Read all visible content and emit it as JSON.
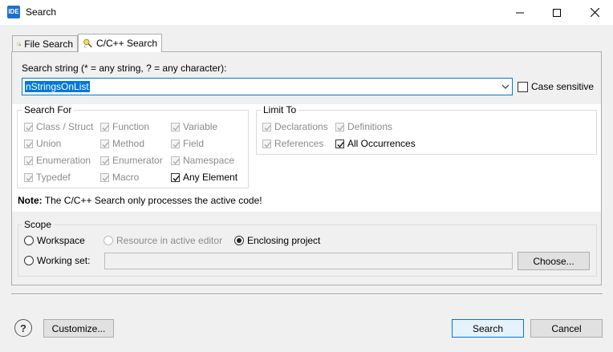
{
  "window": {
    "title": "Search",
    "app_icon_text": "IDE",
    "accent": "#0078d7"
  },
  "tabs": [
    {
      "label": "File Search",
      "icon": "file-search-icon"
    },
    {
      "label": "C/C++ Search",
      "icon": "cpp-search-icon",
      "active": true
    }
  ],
  "search": {
    "label": "Search string (* = any string, ? = any character):",
    "value": "nStringsOnList",
    "case_sensitive_label": "Case sensitive",
    "case_sensitive": false
  },
  "search_for": {
    "title": "Search For",
    "options": [
      {
        "label": "Class / Struct",
        "checked": true,
        "enabled": false
      },
      {
        "label": "Function",
        "checked": true,
        "enabled": false
      },
      {
        "label": "Variable",
        "checked": true,
        "enabled": false
      },
      {
        "label": "Union",
        "checked": true,
        "enabled": false
      },
      {
        "label": "Method",
        "checked": true,
        "enabled": false
      },
      {
        "label": "Field",
        "checked": true,
        "enabled": false
      },
      {
        "label": "Enumeration",
        "checked": true,
        "enabled": false
      },
      {
        "label": "Enumerator",
        "checked": true,
        "enabled": false
      },
      {
        "label": "Namespace",
        "checked": true,
        "enabled": false
      },
      {
        "label": "Typedef",
        "checked": true,
        "enabled": false
      },
      {
        "label": "Macro",
        "checked": true,
        "enabled": false
      },
      {
        "label": "Any Element",
        "checked": true,
        "enabled": true
      }
    ]
  },
  "limit_to": {
    "title": "Limit To",
    "options": [
      {
        "label": "Declarations",
        "checked": true,
        "enabled": false
      },
      {
        "label": "Definitions",
        "checked": true,
        "enabled": false
      },
      {
        "label": "References",
        "checked": true,
        "enabled": false
      },
      {
        "label": "All Occurrences",
        "checked": true,
        "enabled": true
      }
    ]
  },
  "note": {
    "bold": "Note:",
    "text": "The C/C++ Search only processes the active code!"
  },
  "scope": {
    "title": "Scope",
    "workspace": "Workspace",
    "resource_in_editor": "Resource in active editor",
    "enclosing_project": "Enclosing project",
    "working_set": "Working set:",
    "working_set_value": "",
    "choose_button": "Choose...",
    "selected": "Enclosing project"
  },
  "footer": {
    "customize_button": "Customize...",
    "search_button": "Search",
    "cancel_button": "Cancel"
  }
}
